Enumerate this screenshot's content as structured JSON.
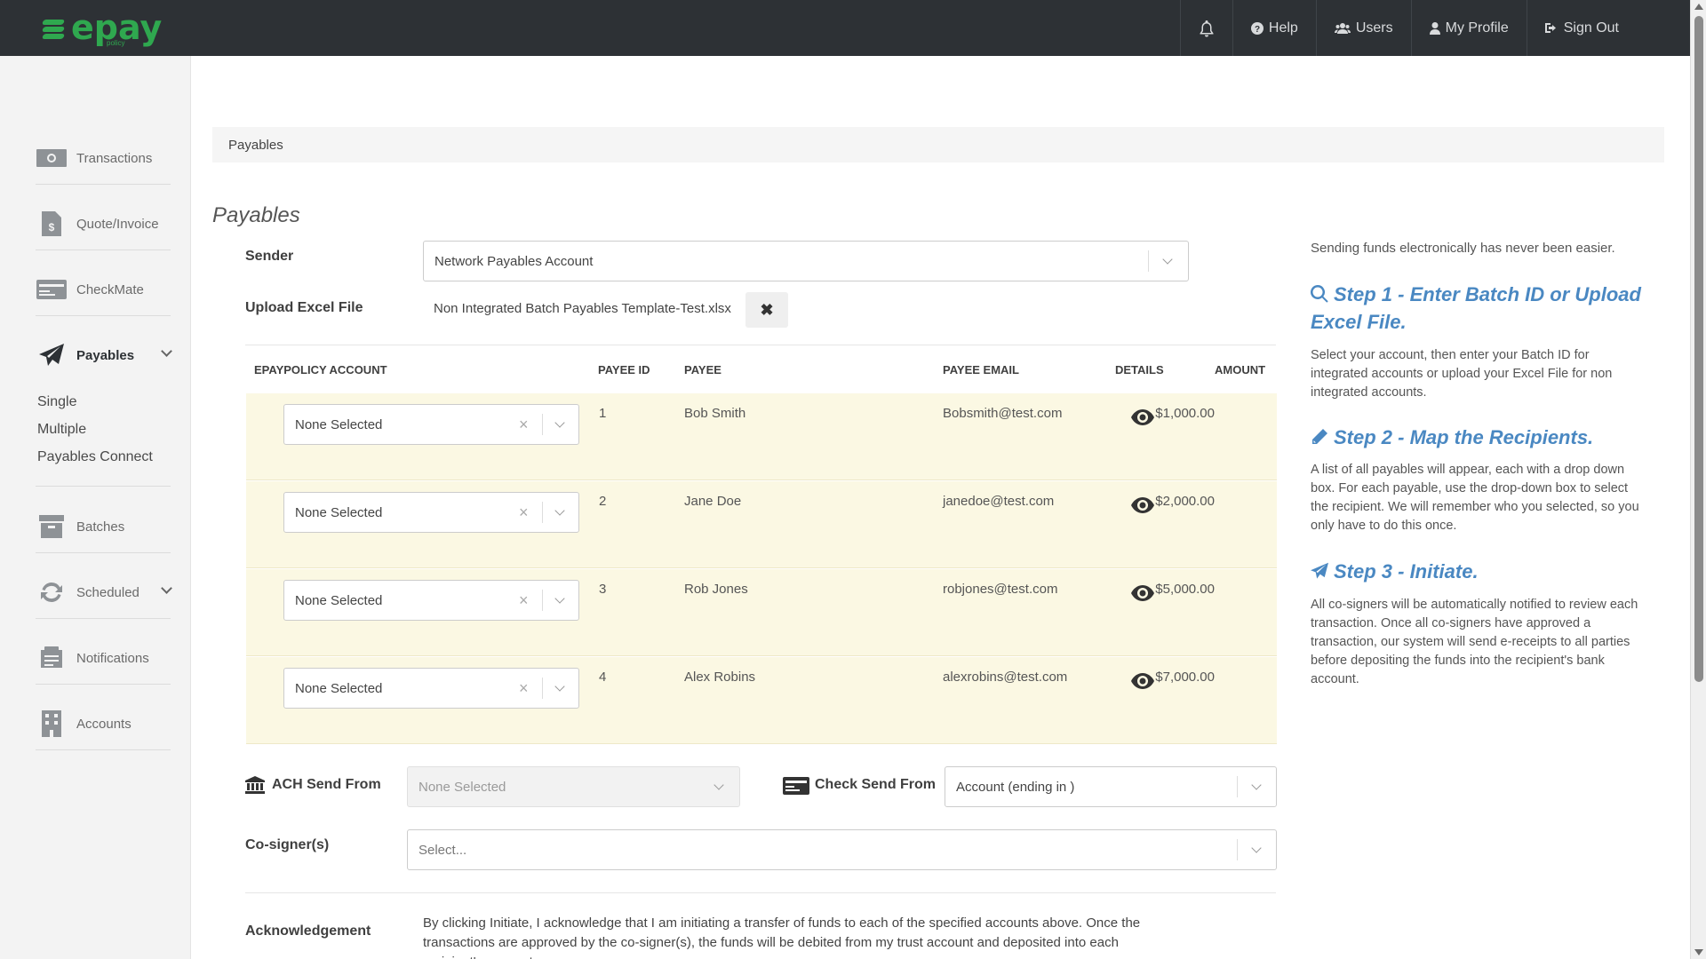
{
  "topbar": {
    "logo_text": "epay",
    "logo_sub": "policy",
    "nav": [
      {
        "label": "Help",
        "icon": "question-circle-icon"
      },
      {
        "label": "Users",
        "icon": "users-icon"
      },
      {
        "label": "My Profile",
        "icon": "user-icon"
      },
      {
        "label": "Sign Out",
        "icon": "sign-out-icon"
      }
    ]
  },
  "sidebar": {
    "items": [
      {
        "label": "Transactions",
        "icon": "money-icon"
      },
      {
        "label": "Quote/Invoice",
        "icon": "invoice-icon"
      },
      {
        "label": "CheckMate",
        "icon": "check-icon"
      },
      {
        "label": "Payables",
        "icon": "paper-plane-icon"
      },
      {
        "label": "Batches",
        "icon": "archive-icon"
      },
      {
        "label": "Scheduled",
        "icon": "refresh-icon"
      },
      {
        "label": "Notifications",
        "icon": "notifications-icon"
      },
      {
        "label": "Accounts",
        "icon": "building-icon"
      }
    ],
    "payables_sub": [
      "Single",
      "Multiple",
      "Payables Connect"
    ]
  },
  "breadcrumb": "Payables",
  "page_title": "Payables",
  "form": {
    "sender_label": "Sender",
    "sender_value": "Network Payables Account",
    "upload_label": "Upload Excel File",
    "file_name": "Non Integrated Batch Payables Template-Test.xlsx",
    "file_clear": "✖"
  },
  "table": {
    "headers": [
      "EPAYPOLICY ACCOUNT",
      "PAYEE ID",
      "PAYEE",
      "PAYEE EMAIL",
      "DETAILS",
      "AMOUNT"
    ],
    "rows": [
      {
        "account": "None Selected",
        "id": "1",
        "payee": "Bob Smith",
        "email": "Bobsmith@test.com",
        "amount": "$1,000.00"
      },
      {
        "account": "None Selected",
        "id": "2",
        "payee": "Jane Doe",
        "email": "janedoe@test.com",
        "amount": "$2,000.00"
      },
      {
        "account": "None Selected",
        "id": "3",
        "payee": "Rob Jones",
        "email": "robjones@test.com",
        "amount": "$5,000.00"
      },
      {
        "account": "None Selected",
        "id": "4",
        "payee": "Alex Robins",
        "email": "alexrobins@test.com",
        "amount": "$7,000.00"
      }
    ]
  },
  "send": {
    "ach_label": "ACH Send From",
    "ach_value": "None Selected",
    "check_label": "Check Send From",
    "check_value": "Account (ending in )",
    "cosigner_label": "Co-signer(s)",
    "cosigner_placeholder": "Select..."
  },
  "ack": {
    "label": "Acknowledgement",
    "text": "By clicking Initiate, I acknowledge that I am initiating a transfer of funds to each of the specified accounts above. Once the transactions are approved by the co-signer(s), the funds will be debited from my trust account and deposited into each recipient's account."
  },
  "help": {
    "intro": "Sending funds electronically has never been easier.",
    "steps": [
      {
        "title": "Step 1 - Enter Batch ID or Upload Excel File.",
        "body": "Select your account, then enter your Batch ID for integrated accounts or upload your Excel File for non integrated accounts.",
        "icon": "search-icon"
      },
      {
        "title": "Step 2 - Map the Recipients.",
        "body": "A list of all payables will appear, each with a drop down box. For each payable, use the drop-down box to select the recipient. We will remember who you selected, so you only have to do this once.",
        "icon": "pencil-icon"
      },
      {
        "title": "Step 3 - Initiate.",
        "body": "All co-signers will be automatically notified to review each transaction. Once all co-signers have approved a transaction, our system will send e-receipts to all parties before depositing the funds into the recipient's bank account.",
        "icon": "paper-plane-icon"
      }
    ]
  },
  "colors": {
    "topbar": "#2d3135",
    "brand_green": "#2fa84f",
    "step_blue": "#4a88c2",
    "row_highlight": "#fbf8e3"
  }
}
